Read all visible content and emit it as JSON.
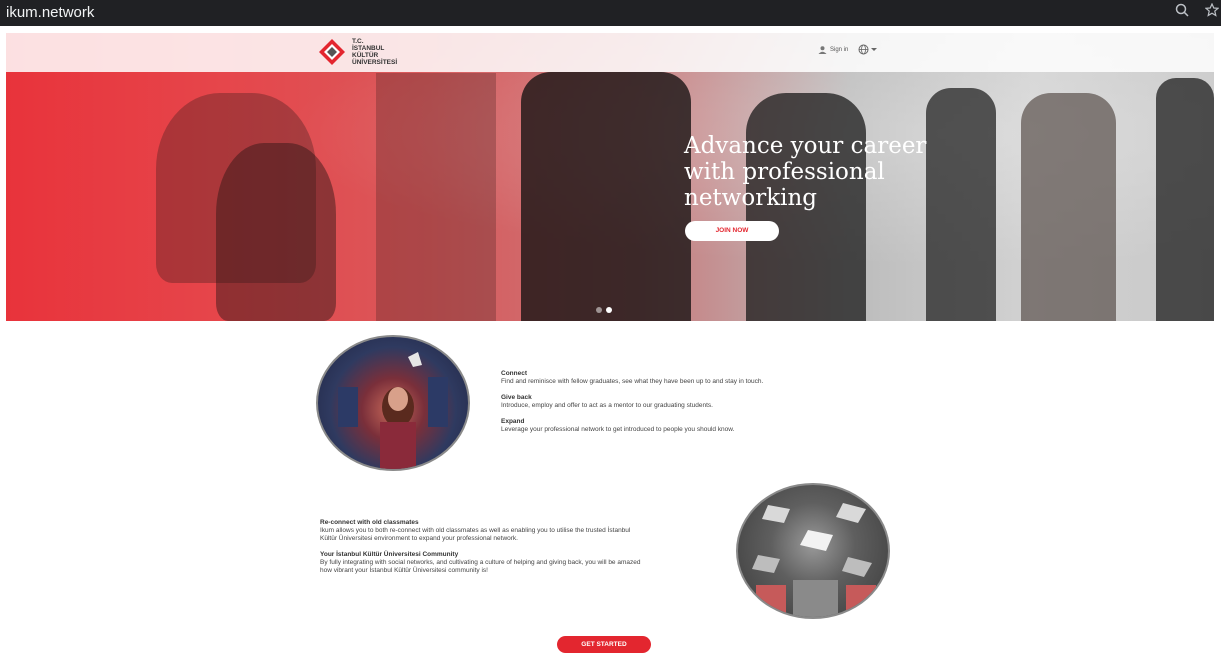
{
  "browser": {
    "title": "ikum.network",
    "icons": [
      "search-icon",
      "star-icon"
    ]
  },
  "nav": {
    "logo_lines": [
      "T.C.",
      "İSTANBUL",
      "KÜLTÜR",
      "ÜNİVERSİTESİ"
    ],
    "signin_label": "Sign in",
    "language_icon": "globe-icon"
  },
  "hero": {
    "headline": "Advance your career with professional networking",
    "join_label": "JOIN NOW",
    "slides": 2,
    "active_slide": 1
  },
  "features": [
    {
      "title": "Connect",
      "text": "Find and reminisce with fellow graduates, see what they have been up to and stay in touch."
    },
    {
      "title": "Give back",
      "text": "Introduce, employ and offer to act as a mentor to our graduating students."
    },
    {
      "title": "Expand",
      "text": "Leverage your professional network to get introduced to people you should know."
    }
  ],
  "community": [
    {
      "title": "Re-connect with old classmates",
      "lines": [
        "Ikum allows you to both re-connect with old classmates as well as enabling you to utilise the trusted İstanbul",
        "Kültür Üniversitesi environment to expand your professional network."
      ]
    },
    {
      "title": "Your İstanbul Kültür Üniversitesi Community",
      "lines": [
        "By fully integrating with social networks, and cultivating a culture of helping and giving back, you will be amazed",
        "how vibrant your İstanbul Kültür Üniversitesi community is!"
      ]
    }
  ],
  "cta_label": "GET STARTED",
  "colors": {
    "brand_red": "#e3262f",
    "browser_bar": "#202124"
  }
}
